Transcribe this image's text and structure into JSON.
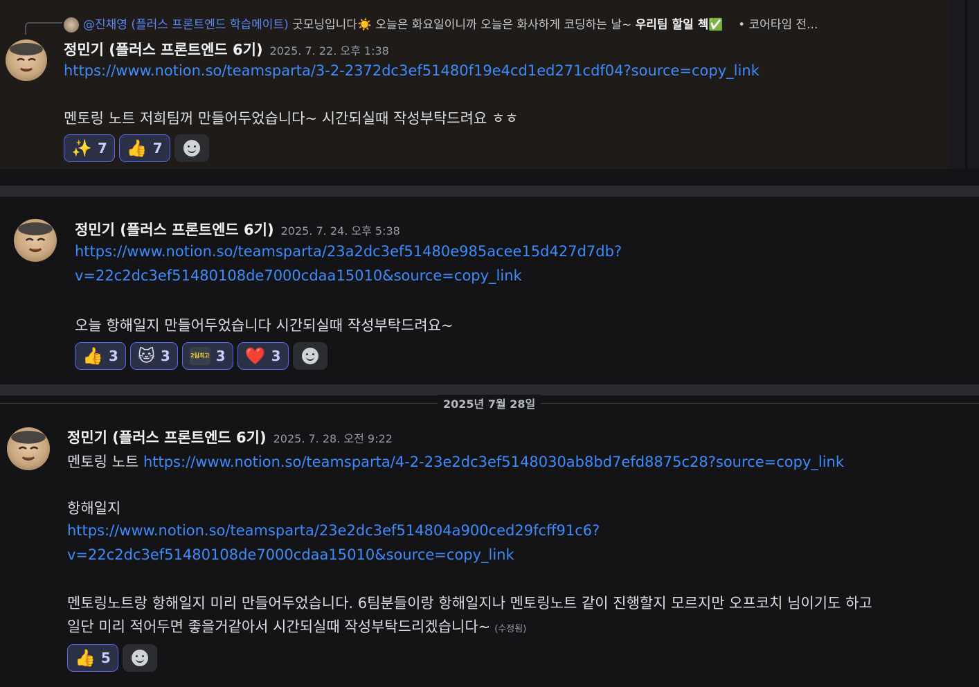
{
  "messages": [
    {
      "reply_to": {
        "mention": "@진채영 (플러스 프론트엔드 학습메이트)",
        "text": "굿모닝입니다☀️ 오늘은 화요일이니까 오늘은 화사하게 코딩하는 날~ ",
        "bold_text": "우리팀 할일 첵✅",
        "rest": "    • 코어타임 전..."
      },
      "author": "정민기 (플러스 프론트엔드 6기)",
      "timestamp": "2025. 7. 22. 오후 1:38",
      "link": "https://www.notion.so/teamsparta/3-2-2372dc3ef51480f19e4cd1ed271cdf04?source=copy_link",
      "body": "멘토링 노트 저희팀꺼 만들어두었습니다~ 시간되실때 작성부탁드려요 ㅎㅎ",
      "reactions": [
        {
          "emoji": "✨",
          "count": "7"
        },
        {
          "emoji": "👍",
          "count": "7"
        }
      ]
    },
    {
      "author": "정민기 (플러스 프론트엔드 6기)",
      "timestamp": "2025. 7. 24. 오후 5:38",
      "link_line1": "https://www.notion.so/teamsparta/23a2dc3ef51480e985acee15d427d7db?",
      "link_line2": "v=22c2dc3ef51480108de7000cdaa15010&source=copy_link",
      "body": "오늘 항해일지 만들어두었습니다 시간되실때 작성부탁드려요~",
      "reactions": [
        {
          "emoji": "👍",
          "count": "3"
        },
        {
          "emoji": "🐱",
          "count": "3"
        },
        {
          "emoji": "2팀최고",
          "count": "3"
        },
        {
          "emoji": "❤️",
          "count": "3"
        }
      ]
    },
    {
      "date_divider": "2025년 7월 28일",
      "author": "정민기 (플러스 프론트엔드 6기)",
      "timestamp": "2025. 7. 28. 오전 9:22",
      "prefix": "멘토링 노트 ",
      "link": "https://www.notion.so/teamsparta/4-2-23e2dc3ef5148030ab8bd7efd8875c28?source=copy_link",
      "heading": "항해일지",
      "link2_line1": "https://www.notion.so/teamsparta/23e2dc3ef514804a900ced29fcff91c6?",
      "link2_line2": "v=22c2dc3ef51480108de7000cdaa15010&source=copy_link",
      "body_line1": "멘토링노트랑 항해일지 미리 만들어두었습니다. 6팀분들이랑 항해일지나 멘토링노트 같이 진행할지 모르지만 오프코치 님이기도 하고",
      "body_line2": "일단 미리 적어두면 좋을거같아서 시간되실때 작성부탁드리겠습니다~",
      "edited": "(수정됨)",
      "reactions": [
        {
          "emoji": "👍",
          "count": "5"
        }
      ]
    }
  ]
}
